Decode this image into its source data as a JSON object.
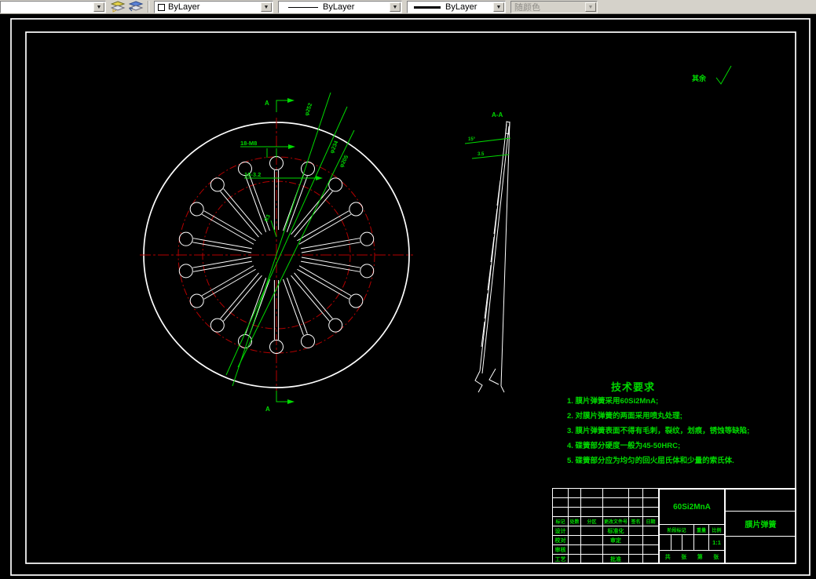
{
  "toolbar": {
    "layer_combo_value": "",
    "color_value": "ByLayer",
    "linetype_value": "ByLayer",
    "lineweight_value": "ByLayer",
    "plotstyle_value": "随颜色",
    "dropdown_glyph": "▼"
  },
  "colors": {
    "dim_green": "#00d900",
    "centerline_red": "#b40000",
    "entity_white": "#ffffff",
    "toolbar_bg": "#d5d2ca"
  },
  "front_view": {
    "hole_count": 18,
    "dia_labels": [
      "φ252",
      "φ234",
      "φ205"
    ],
    "thread_label": "18-M8",
    "slot_label": "18-3.2",
    "radius_label": "R3",
    "section_label_top": "A",
    "section_label_bottom": "A"
  },
  "section_view": {
    "label": "A-A",
    "dims": [
      "15°",
      "3.5"
    ]
  },
  "surface_note": "其余",
  "tech_requirements": {
    "title": "技术要求",
    "items": [
      "1. 膜片弹簧采用60Si2MnA;",
      "2. 对膜片弹簧的两面采用喷丸处理;",
      "3. 膜片弹簧表面不得有毛刺，裂纹，划痕，锈蚀等缺陷;",
      "4. 碟簧部分硬度一般为45-50HRC;",
      "5. 碟簧部分应为均匀的回火屈氏体和少量的索氏体."
    ]
  },
  "title_block": {
    "material": "60Si2MnA",
    "part_name": "膜片弹簧",
    "revision_headers": [
      "标记",
      "处数",
      "分区",
      "更改文件号",
      "签名",
      "日期"
    ],
    "sign_rows": [
      [
        "设计",
        "标准化"
      ],
      [
        "校对",
        "审定"
      ],
      [
        "审核",
        ""
      ],
      [
        "工艺",
        "批准"
      ]
    ],
    "stage_header": "阶段标记",
    "weight_header": "重量",
    "scale_header": "比例",
    "scale_value": "1:1",
    "sheet_row": [
      "共",
      "张",
      "第",
      "张"
    ]
  }
}
